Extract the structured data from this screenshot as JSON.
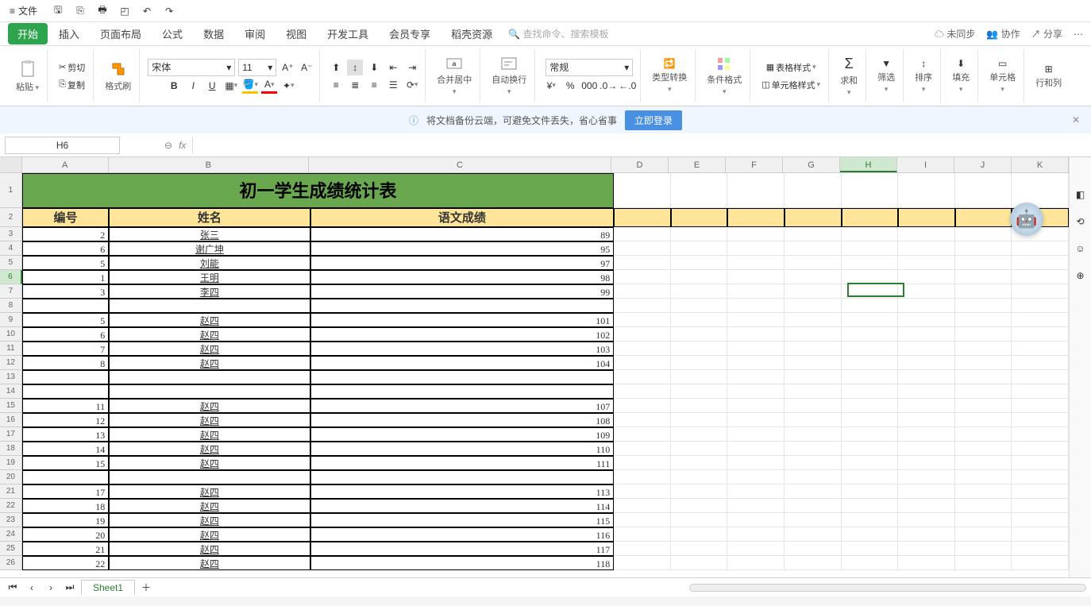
{
  "titlebar": {
    "file_label": "文件"
  },
  "tabs": {
    "items": [
      "开始",
      "插入",
      "页面布局",
      "公式",
      "数据",
      "审阅",
      "视图",
      "开发工具",
      "会员专享",
      "稻壳资源"
    ],
    "active_index": 0,
    "search_placeholder": "查找命令、搜索模板",
    "right": {
      "unsync": "未同步",
      "coop": "协作",
      "share": "分享"
    }
  },
  "ribbon": {
    "paste": "粘贴",
    "cut": "剪切",
    "copy": "复制",
    "format_painter": "格式刷",
    "font_name": "宋体",
    "font_size": "11",
    "merge_center": "合并居中",
    "auto_wrap": "自动换行",
    "number_format": "常规",
    "type_convert": "类型转换",
    "cond_format": "条件格式",
    "table_style": "表格样式",
    "cell_style": "单元格样式",
    "sum": "求和",
    "filter": "筛选",
    "sort": "排序",
    "fill": "填充",
    "cell": "单元格",
    "row_col": "行和列"
  },
  "notice": {
    "text": "将文档备份云端，可避免文件丢失，省心省事",
    "login": "立即登录"
  },
  "namebox": "H6",
  "sheet": {
    "title": "初一学生成绩统计表",
    "headers": {
      "col_a": "编号",
      "col_b": "姓名",
      "col_c": "语文成绩"
    },
    "rows": [
      {
        "r": 3,
        "a": "2",
        "b": "张三",
        "c": "89"
      },
      {
        "r": 4,
        "a": "6",
        "b": "谢广坤",
        "c": "95"
      },
      {
        "r": 5,
        "a": "5",
        "b": "刘能",
        "c": "97"
      },
      {
        "r": 6,
        "a": "1",
        "b": "王明",
        "c": "98"
      },
      {
        "r": 7,
        "a": "3",
        "b": "李四",
        "c": "99"
      },
      {
        "r": 8,
        "a": "",
        "b": "",
        "c": ""
      },
      {
        "r": 9,
        "a": "5",
        "b": "赵四",
        "c": "101"
      },
      {
        "r": 10,
        "a": "6",
        "b": "赵四",
        "c": "102"
      },
      {
        "r": 11,
        "a": "7",
        "b": "赵四",
        "c": "103"
      },
      {
        "r": 12,
        "a": "8",
        "b": "赵四",
        "c": "104"
      },
      {
        "r": 13,
        "a": "",
        "b": "",
        "c": ""
      },
      {
        "r": 14,
        "a": "",
        "b": "",
        "c": ""
      },
      {
        "r": 15,
        "a": "11",
        "b": "赵四",
        "c": "107"
      },
      {
        "r": 16,
        "a": "12",
        "b": "赵四",
        "c": "108"
      },
      {
        "r": 17,
        "a": "13",
        "b": "赵四",
        "c": "109"
      },
      {
        "r": 18,
        "a": "14",
        "b": "赵四",
        "c": "110"
      },
      {
        "r": 19,
        "a": "15",
        "b": "赵四",
        "c": "111"
      },
      {
        "r": 20,
        "a": "",
        "b": "",
        "c": ""
      },
      {
        "r": 21,
        "a": "17",
        "b": "赵四",
        "c": "113"
      },
      {
        "r": 22,
        "a": "18",
        "b": "赵四",
        "c": "114"
      },
      {
        "r": 23,
        "a": "19",
        "b": "赵四",
        "c": "115"
      },
      {
        "r": 24,
        "a": "20",
        "b": "赵四",
        "c": "116"
      },
      {
        "r": 25,
        "a": "21",
        "b": "赵四",
        "c": "117"
      },
      {
        "r": 26,
        "a": "22",
        "b": "赵四",
        "c": "118"
      }
    ],
    "extra_cols": [
      "D",
      "E",
      "F",
      "G",
      "H",
      "I",
      "J",
      "K"
    ],
    "tab_name": "Sheet1"
  }
}
